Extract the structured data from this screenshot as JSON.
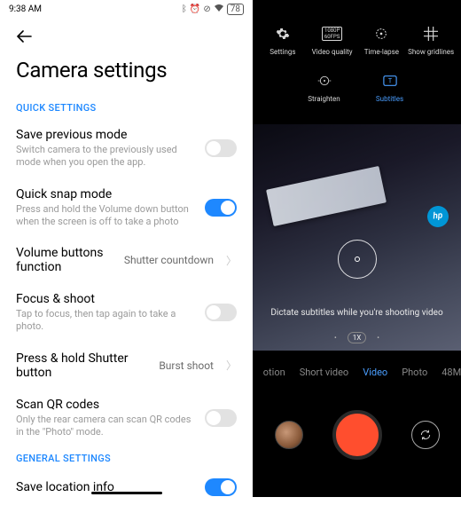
{
  "statusbar": {
    "time": "9:38 AM",
    "battery": "78"
  },
  "page": {
    "title": "Camera settings",
    "quick_header": "QUICK SETTINGS",
    "general_header": "GENERAL SETTINGS"
  },
  "settings": {
    "save_prev": {
      "title": "Save previous mode",
      "sub": "Switch camera to the previously used mode when you open the app.",
      "on": false
    },
    "quick_snap": {
      "title": "Quick snap mode",
      "sub": "Press and hold the Volume down button when the screen is off to take a photo",
      "on": true
    },
    "volume_fn": {
      "title": "Volume buttons function",
      "value": "Shutter countdown"
    },
    "focus_shoot": {
      "title": "Focus & shoot",
      "sub": "Tap to focus, then tap again to take a photo.",
      "on": false
    },
    "press_hold": {
      "title": "Press & hold Shutter button",
      "value": "Burst shoot"
    },
    "scan_qr": {
      "title": "Scan QR codes",
      "sub": "Only the rear camera can scan QR codes in the \"Photo\" mode.",
      "on": false
    },
    "save_loc": {
      "title": "Save location info",
      "on": true
    }
  },
  "camera": {
    "top_row1": {
      "settings": "Settings",
      "video_quality": "Video quality",
      "video_quality_badge_top": "1080P",
      "video_quality_badge_bottom": "60FPS",
      "timelapse": "Time-lapse",
      "gridlines": "Show gridlines"
    },
    "top_row2": {
      "straighten": "Straighten",
      "subtitles": "Subtitles"
    },
    "hint": "Dictate subtitles while you're shooting video",
    "zoom": "1X",
    "hp": "hp",
    "modes": {
      "motion": "otion",
      "short": "Short video",
      "video": "Video",
      "photo": "Photo",
      "m48": "48M"
    }
  }
}
